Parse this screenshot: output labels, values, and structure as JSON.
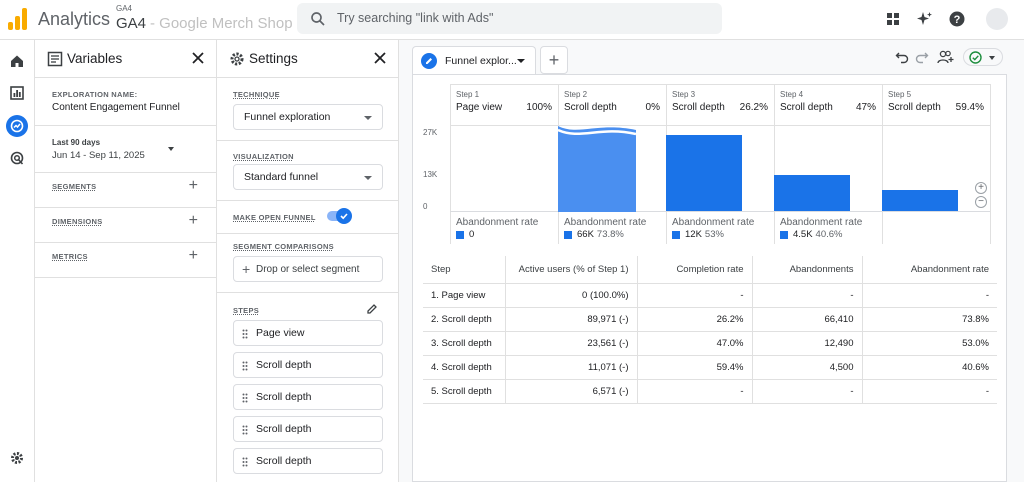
{
  "topbar": {
    "app_name": "Analytics",
    "account_sub": "GA4",
    "account_main": "GA4",
    "property_faded": "- Google Merch Shop",
    "search_placeholder": "Try searching \"link with Ads\"",
    "brand_color": "#f9ab00"
  },
  "variables": {
    "title": "Variables",
    "exploration_name_label": "EXPLORATION NAME:",
    "exploration_name": "Content Engagement Funnel",
    "date_label": "Last 90 days",
    "date_range": "Jun 14 - Sep 11, 2025",
    "segments_label": "SEGMENTS",
    "dimensions_label": "DIMENSIONS",
    "metrics_label": "METRICS"
  },
  "settings": {
    "title": "Settings",
    "technique_label": "TECHNIQUE",
    "technique_value": "Funnel exploration",
    "visualization_label": "VISUALIZATION",
    "visualization_value": "Standard funnel",
    "open_funnel_label": "MAKE OPEN FUNNEL",
    "open_funnel_on": true,
    "segment_comparisons_label": "SEGMENT COMPARISONS",
    "drop_segment_label": "Drop or select segment",
    "steps_label": "STEPS",
    "steps": [
      "Page view",
      "Scroll depth",
      "Scroll depth",
      "Scroll depth",
      "Scroll depth"
    ]
  },
  "tab": {
    "label": "Funnel explor...",
    "add_label": "+"
  },
  "funnel": {
    "accent": "#1a73e8",
    "accent_light": "#4a8ff0",
    "y_ticks": [
      "27K",
      "13K",
      "0"
    ],
    "abandonment_label": "Abandonment rate",
    "steps": [
      {
        "step": "Step 1",
        "name": "Page view",
        "pct": "100%",
        "abandon_value": "0",
        "abandon_pct": ""
      },
      {
        "step": "Step 2",
        "name": "Scroll depth",
        "pct": "0%",
        "abandon_value": "66K",
        "abandon_pct": "73.8%"
      },
      {
        "step": "Step 3",
        "name": "Scroll depth",
        "pct": "26.2%",
        "abandon_value": "12K",
        "abandon_pct": "53%"
      },
      {
        "step": "Step 4",
        "name": "Scroll depth",
        "pct": "47%",
        "abandon_value": "4.5K",
        "abandon_pct": "40.6%"
      },
      {
        "step": "Step 5",
        "name": "Scroll depth",
        "pct": "59.4%",
        "abandon_value": "",
        "abandon_pct": ""
      }
    ]
  },
  "table": {
    "headers": [
      "Step",
      "Active users (% of Step 1)",
      "Completion rate",
      "Abandonments",
      "Abandonment rate"
    ],
    "rows": [
      [
        "1. Page view",
        "0 (100.0%)",
        "-",
        "-",
        "-"
      ],
      [
        "2. Scroll depth",
        "89,971 (-)",
        "26.2%",
        "66,410",
        "73.8%"
      ],
      [
        "3. Scroll depth",
        "23,561 (-)",
        "47.0%",
        "12,490",
        "53.0%"
      ],
      [
        "4. Scroll depth",
        "11,071 (-)",
        "59.4%",
        "4,500",
        "40.6%"
      ],
      [
        "5. Scroll depth",
        "6,571 (-)",
        "-",
        "-",
        "-"
      ]
    ]
  }
}
